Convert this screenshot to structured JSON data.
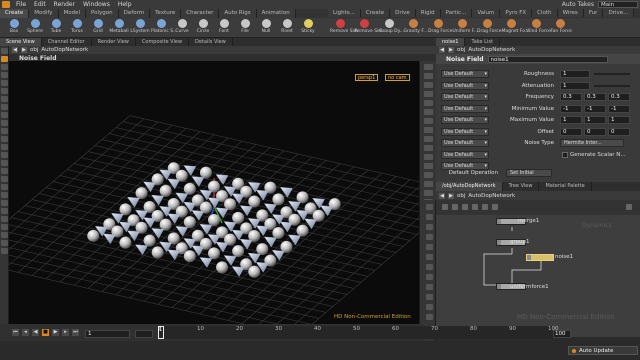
{
  "menubar": {
    "items": [
      "File",
      "Edit",
      "Render",
      "Windows",
      "Help"
    ],
    "auto_takes": "Auto Takes",
    "desktop": "Main"
  },
  "shelf_tabs_left": [
    "Create",
    "Modify",
    "Model",
    "Polygon",
    "Deform",
    "Texture",
    "Character",
    "Auto Rigs",
    "Animation"
  ],
  "shelf_tabs_right": [
    "Lights...",
    "Create",
    "Drive",
    "Rigid",
    "Partic...",
    "Valum",
    "Pyro FX",
    "Cloth",
    "Wires",
    "Fur",
    "Drive..."
  ],
  "shelf_tools": [
    {
      "label": "Box",
      "color": "#7aa3d6"
    },
    {
      "label": "Sphere",
      "color": "#7aa3d6"
    },
    {
      "label": "Tube",
      "color": "#7aa3d6"
    },
    {
      "label": "Torus",
      "color": "#7aa3d6"
    },
    {
      "label": "Grid",
      "color": "#7aa3d6"
    },
    {
      "label": "Metaball",
      "color": "#7aa3d6"
    },
    {
      "label": "LSystem",
      "color": "#7aa3d6"
    },
    {
      "label": "Platonic S...",
      "color": "#7aa3d6"
    },
    {
      "label": "Curve",
      "color": "#c8c8c8"
    },
    {
      "label": "Circle",
      "color": "#c8c8c8"
    },
    {
      "label": "Font",
      "color": "#c8c8c8"
    },
    {
      "label": "File",
      "color": "#c8c8c8"
    },
    {
      "label": "Null",
      "color": "#c8c8c8"
    },
    {
      "label": "Rivet",
      "color": "#c8c8c8"
    },
    {
      "label": "Sticky",
      "color": "#e0d060"
    },
    {
      "label": "Remove Sim",
      "color": "#d04040"
    },
    {
      "label": "Remove Sim...",
      "color": "#d04040"
    },
    {
      "label": "Group Dy...",
      "color": "#c8c8c8"
    },
    {
      "label": "Gravity F...",
      "color": "#c88040"
    },
    {
      "label": "Drag Force",
      "color": "#c88040"
    },
    {
      "label": "Uniform F...",
      "color": "#c88040"
    },
    {
      "label": "Drag Force",
      "color": "#c88040"
    },
    {
      "label": "Magnet Fo...",
      "color": "#c88040"
    },
    {
      "label": "Wind Force",
      "color": "#c88040"
    },
    {
      "label": "Fan Force",
      "color": "#c88040"
    }
  ],
  "left_pane_tabs": [
    "Scene View",
    "Channel Editor",
    "Render View",
    "Composite View",
    "Details View"
  ],
  "viewport": {
    "path_obj": "obj",
    "path_network": "AutoDopNetwork",
    "title": "Noise Field",
    "camera": "persp1",
    "cam_menu": "no cam",
    "watermark": "HD Non-Commercial Edition"
  },
  "param_tabs": [
    "noise1",
    "Take List"
  ],
  "param": {
    "path_obj": "obj",
    "path_network": "AutoDopNetwork",
    "node_type": "Noise Field",
    "node_name": "noise1",
    "use_default": "Use Default",
    "rows": [
      {
        "label": "Roughness",
        "values": [
          "1"
        ]
      },
      {
        "label": "Attenuation",
        "values": [
          "1"
        ]
      },
      {
        "label": "Frequency",
        "values": [
          "0.3",
          "0.3",
          "0.3"
        ]
      },
      {
        "label": "Minimum Value",
        "values": [
          "-1",
          "-1",
          "-1"
        ]
      },
      {
        "label": "Maximum Value",
        "values": [
          "1",
          "1",
          "1"
        ]
      },
      {
        "label": "Offset",
        "values": [
          "0",
          "0",
          "0"
        ]
      },
      {
        "label": "Noise Type",
        "values": [
          "Hermite Inter..."
        ]
      },
      {
        "label": "",
        "values": [
          "Generate Scalar N..."
        ]
      },
      {
        "label": "",
        "values": []
      }
    ],
    "default_operation_label": "Default Operation",
    "default_operation_value": "Set Initial"
  },
  "network": {
    "tabs": [
      "/obj/AutoDopNetwork",
      "Tree View",
      "Material Palette"
    ],
    "path_obj": "obj",
    "path_network": "AutoDopNetwork",
    "nodes": [
      "merge1",
      "group1",
      "noise1",
      "uniformforce1"
    ],
    "watermark": "HD Non-Commercial Edition",
    "context_label": "Dynamics"
  },
  "timeline": {
    "current_frame": "1",
    "start_frame": "1",
    "end_frame": "100",
    "ticks": [
      "1",
      "10",
      "20",
      "30",
      "40",
      "50",
      "60",
      "70",
      "80",
      "90",
      "100"
    ]
  },
  "statusbar": {
    "auto_update": "Auto Update"
  }
}
